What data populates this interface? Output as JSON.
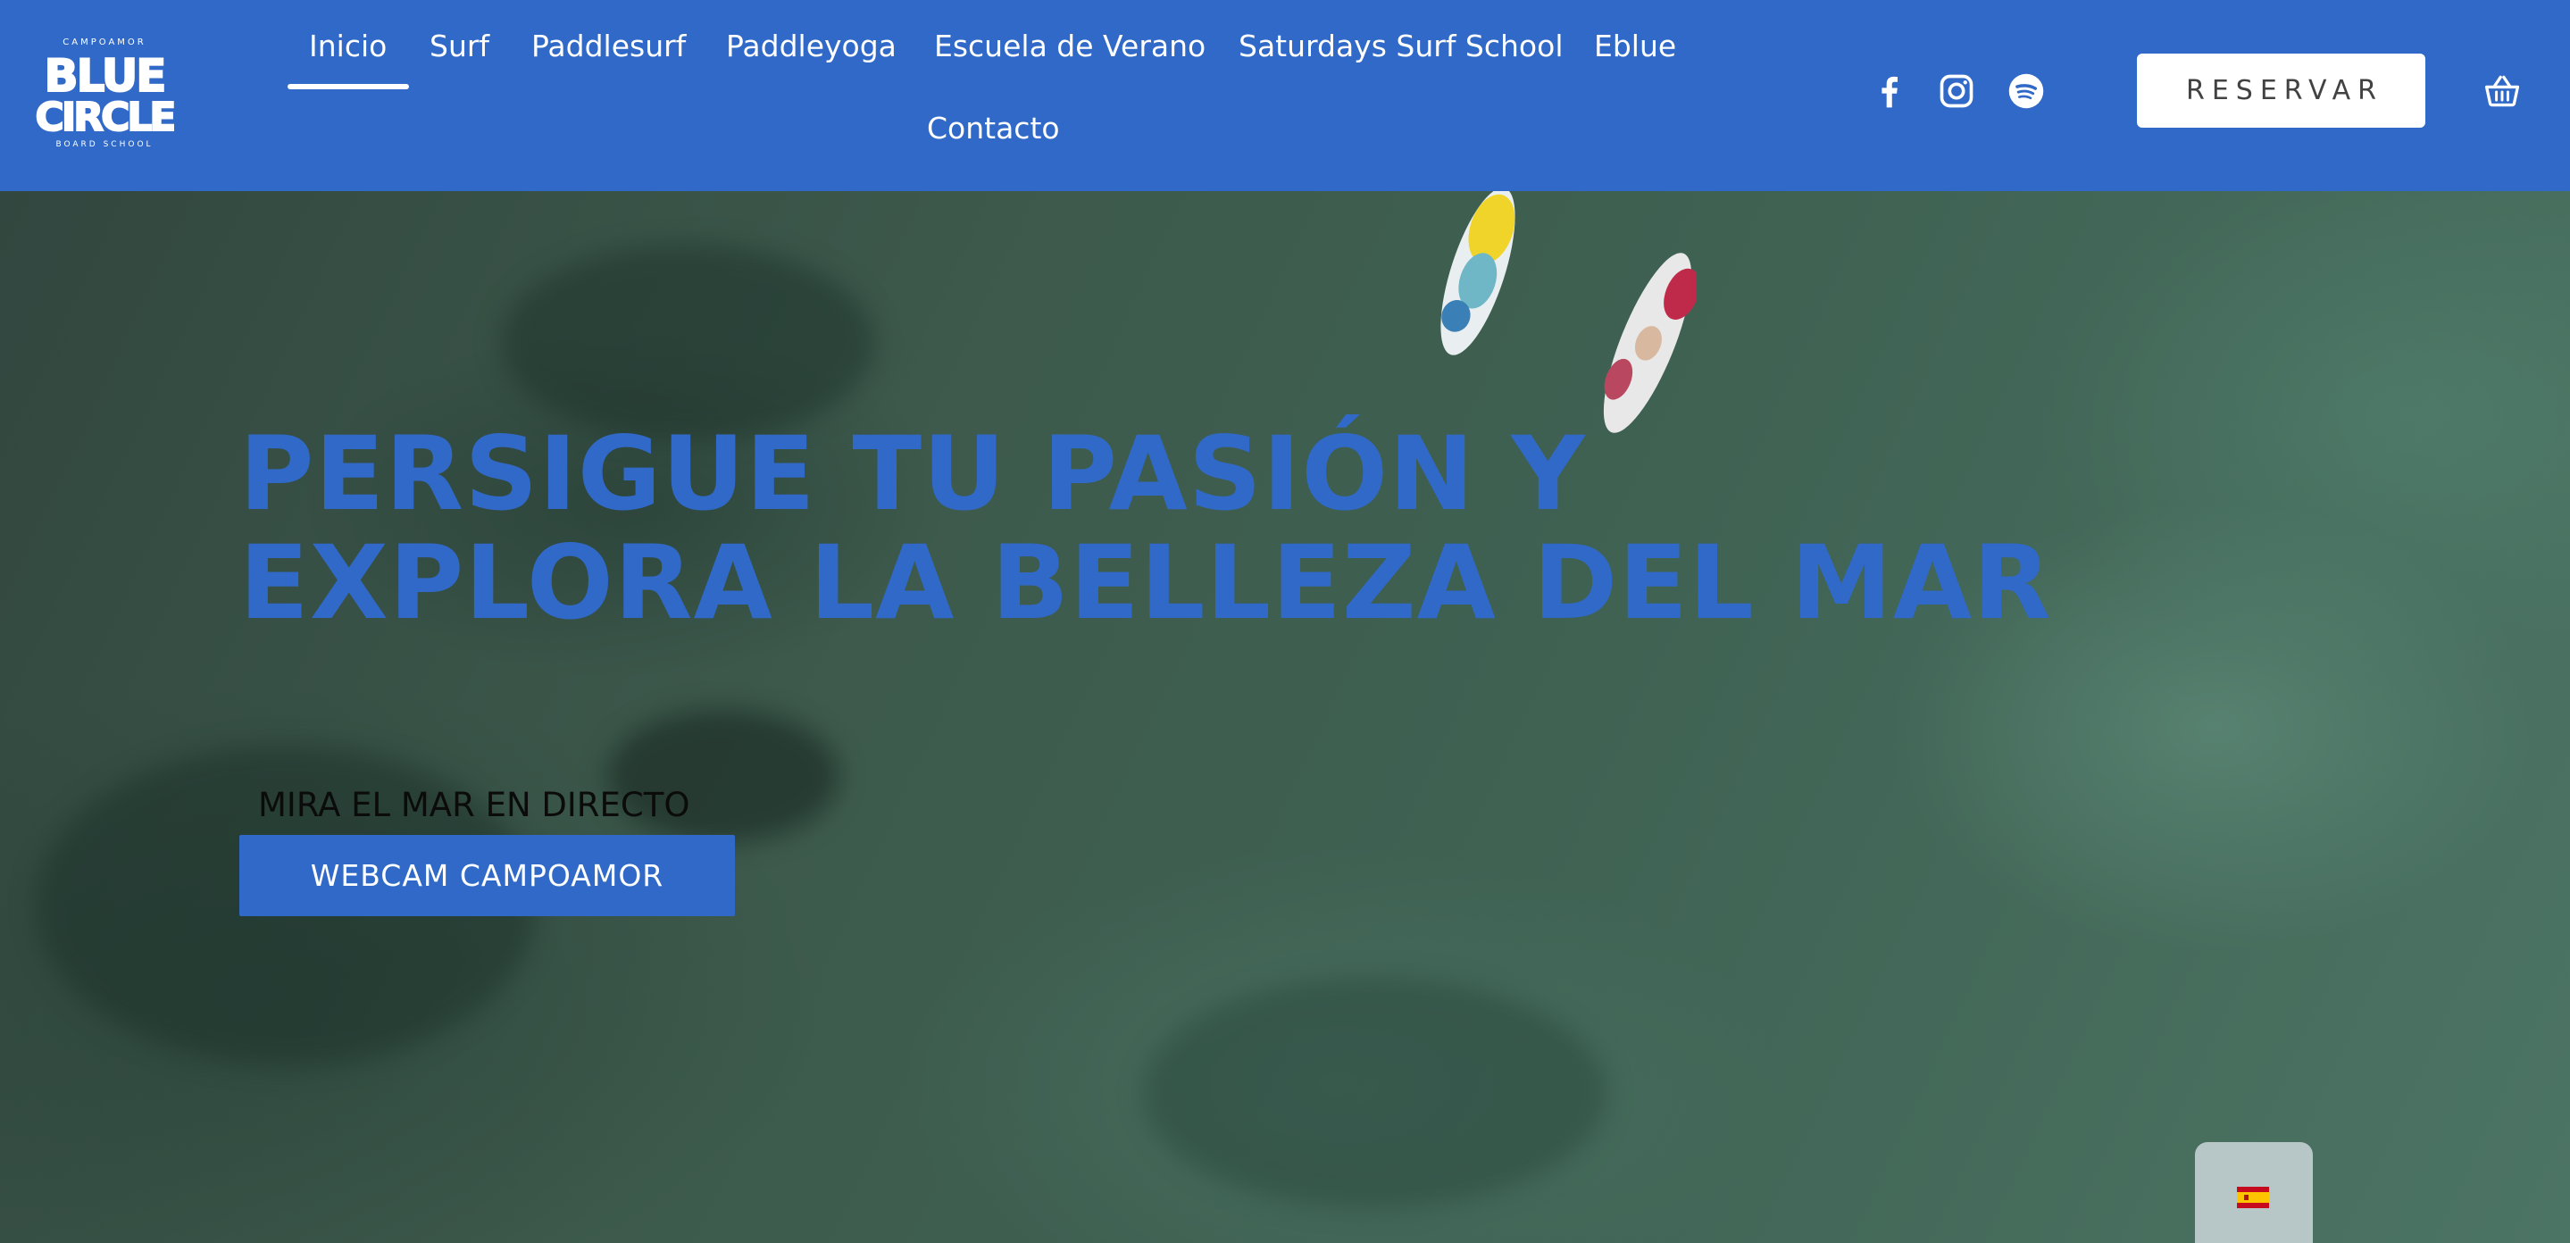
{
  "brand": {
    "logo_top": "CAMPOAMOR",
    "logo_line1": "BLUE",
    "logo_line2": "CIRCLE",
    "logo_bottom": "BOARD SCHOOL",
    "primary_color": "#3069c7"
  },
  "nav": {
    "items": [
      {
        "label": "Inicio",
        "active": true
      },
      {
        "label": "Surf"
      },
      {
        "label": "Paddlesurf"
      },
      {
        "label": "Paddleyoga"
      },
      {
        "label": "Escuela de Verano"
      },
      {
        "label": "Saturdays Surf School"
      },
      {
        "label": "Eblue"
      },
      {
        "label": "Contacto"
      }
    ]
  },
  "social": {
    "icons": [
      "facebook-icon",
      "instagram-icon",
      "spotify-icon"
    ]
  },
  "header": {
    "reserve_label": "RESERVAR",
    "cart_icon": "basket-icon"
  },
  "hero": {
    "title_line1": "PERSIGUE TU PASIÓN Y",
    "title_line2": "EXPLORA LA BELLEZA DEL MAR",
    "live_label": "MIRA EL MAR EN DIRECTO",
    "webcam_button": "WEBCAM CAMPOAMOR"
  },
  "language_switcher": {
    "flag_icon": "spain-flag-icon"
  }
}
